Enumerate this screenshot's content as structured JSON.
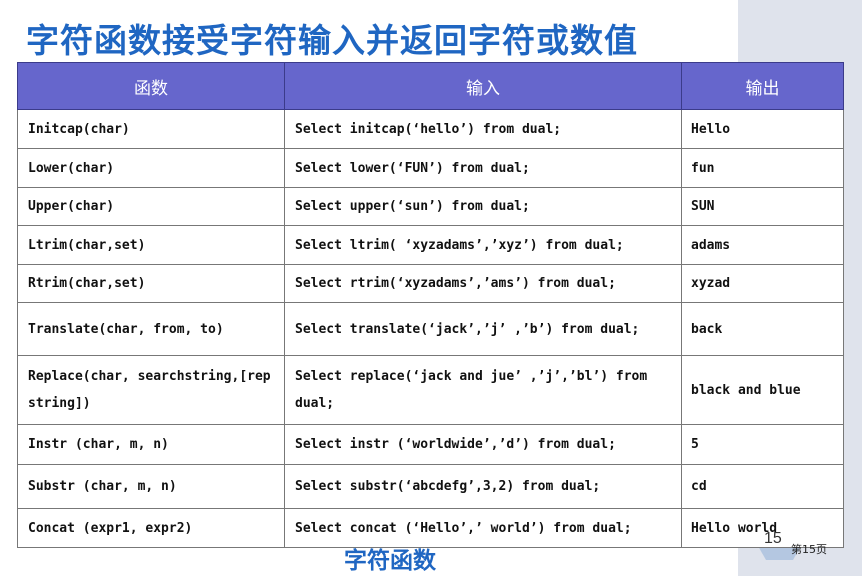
{
  "title": "字符函数接受字符输入并返回字符或数值",
  "table": {
    "headers": [
      "函数",
      "输入",
      "输出"
    ],
    "rows": [
      {
        "function": "Initcap(char)",
        "input": "Select initcap(‘hello’) from dual;",
        "output": "Hello"
      },
      {
        "function": "Lower(char)",
        "input": "Select lower(‘FUN’) from dual;",
        "output": "fun"
      },
      {
        "function": "Upper(char)",
        "input": "Select upper(‘sun’) from dual;",
        "output": "SUN"
      },
      {
        "function": "Ltrim(char,set)",
        "input": "Select ltrim( ‘xyzadams’,’xyz’) from dual;",
        "output": "adams"
      },
      {
        "function": "Rtrim(char,set)",
        "input": "Select rtrim(‘xyzadams’,’ams’) from dual;",
        "output": "xyzad"
      },
      {
        "function": "Translate(char, from, to)",
        "input": "Select translate(‘jack’,’j’ ,’b’) from dual;",
        "output": "back"
      },
      {
        "function": "Replace(char, searchstring,[rep string])",
        "input": "Select replace(‘jack and jue’ ,’j’,’bl’) from dual;",
        "output": "black and blue"
      },
      {
        "function": "Instr (char, m, n)",
        "input": "Select instr (‘worldwide’,’d’) from dual;",
        "output": "5"
      },
      {
        "function": "Substr (char, m, n)",
        "input": "Select substr(‘abcdefg’,3,2) from dual;",
        "output": "cd"
      },
      {
        "function": "Concat (expr1, expr2)",
        "input": "Select concat (‘Hello’,’ world’) from dual;",
        "output": "Hello world"
      }
    ]
  },
  "footer": {
    "label": "字符函数",
    "page_number": "15",
    "page_label": "第15页"
  },
  "colors": {
    "title": "#1f66c2",
    "header_bg": "#6666cc",
    "side_band": "#dfe3ec",
    "hexagon": "#a9bfde"
  }
}
